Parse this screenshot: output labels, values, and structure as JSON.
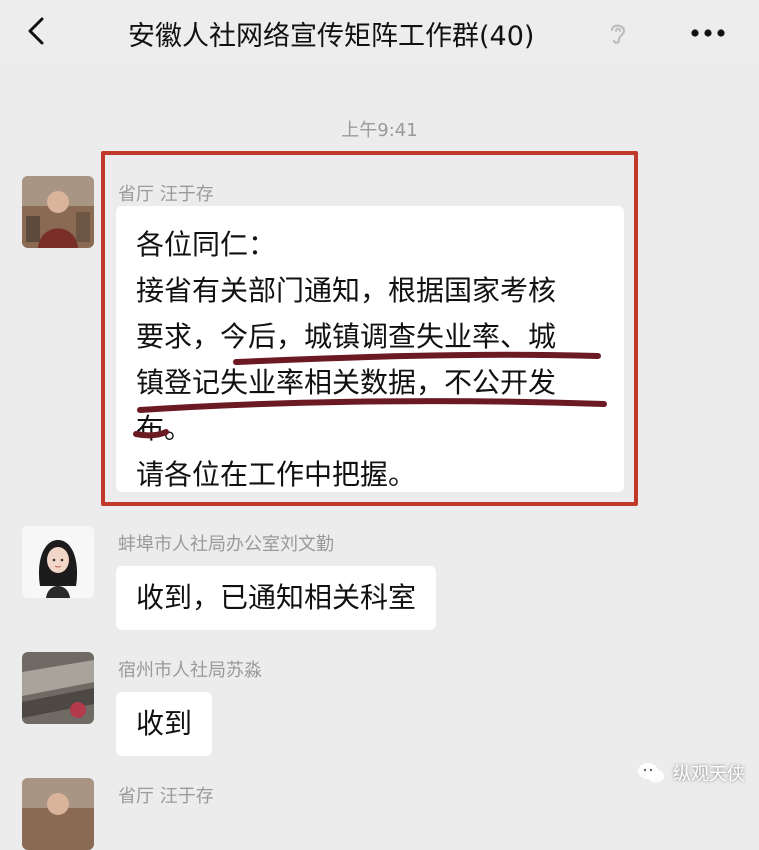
{
  "header": {
    "title": "安徽人社网络宣传矩阵工作群(40)",
    "back_icon": "chevron-left-icon",
    "mute_icon": "ear-icon",
    "more_icon": "more-dots-icon"
  },
  "chat": {
    "timestamp": "上午9:41",
    "messages": [
      {
        "sender": "省厅 汪于存",
        "avatar": "photo-avatar",
        "lines": [
          "各位同仁：",
          "接省有关部门通知，根据国家考核",
          "要求，今后，城镇调查失业率、城",
          "镇登记失业率相关数据，不公开发",
          "布。",
          "请各位在工作中把握。"
        ]
      },
      {
        "sender": "蚌埠市人社局办公室刘文勤",
        "avatar": "cartoon-girl-avatar",
        "text": "收到，已通知相关科室"
      },
      {
        "sender": "宿州市人社局苏淼",
        "avatar": "photo-avatar",
        "text": "收到"
      },
      {
        "sender": "省厅 汪于存",
        "avatar": "photo-avatar"
      }
    ]
  },
  "annotation": {
    "frame_color": "#c0392b",
    "underline_color": "#6b1a24"
  },
  "watermark": {
    "text": "纵观天侠"
  }
}
